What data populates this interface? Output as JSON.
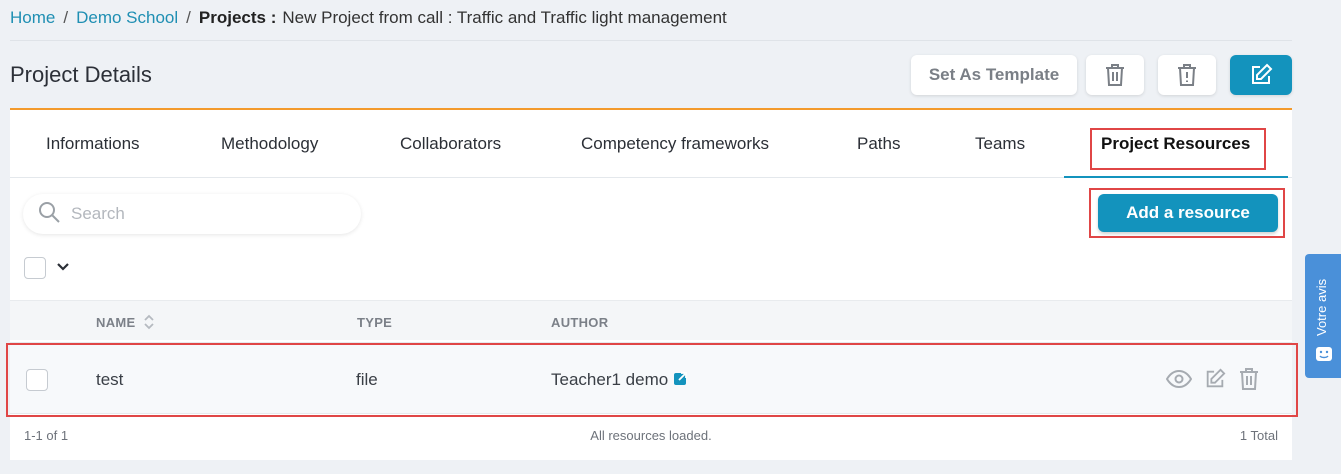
{
  "breadcrumb": {
    "home": "Home",
    "sep1": "/",
    "school": "Demo School",
    "sep2": "/",
    "projects": "Projects :",
    "current": "New Project from call : Traffic and Traffic light management"
  },
  "header": {
    "title": "Project Details",
    "set_template": "Set As Template"
  },
  "tabs": [
    {
      "label": "Informations"
    },
    {
      "label": "Methodology"
    },
    {
      "label": "Collaborators"
    },
    {
      "label": "Competency frameworks"
    },
    {
      "label": "Paths"
    },
    {
      "label": "Teams"
    },
    {
      "label": "Project Resources",
      "active": true
    }
  ],
  "search": {
    "placeholder": "Search",
    "value": ""
  },
  "actions": {
    "add_resource": "Add a resource"
  },
  "table": {
    "columns": [
      "NAME",
      "TYPE",
      "AUTHOR"
    ],
    "rows": [
      {
        "name": "test",
        "type": "file",
        "author": "Teacher1 demo"
      }
    ]
  },
  "footer": {
    "range": "1-1 of 1",
    "status": "All resources loaded.",
    "total": "1 Total"
  },
  "feedback": {
    "label": "Votre avis"
  },
  "colors": {
    "primary": "#1393bd",
    "accent": "#f39a2c",
    "highlight": "#e04646",
    "feedback": "#4a90d9"
  },
  "icons": [
    "search-icon",
    "trash-icon",
    "trash-alert-icon",
    "edit-icon",
    "chevron-down-icon",
    "sort-icon",
    "external-link-icon",
    "eye-icon",
    "smiley-icon"
  ]
}
